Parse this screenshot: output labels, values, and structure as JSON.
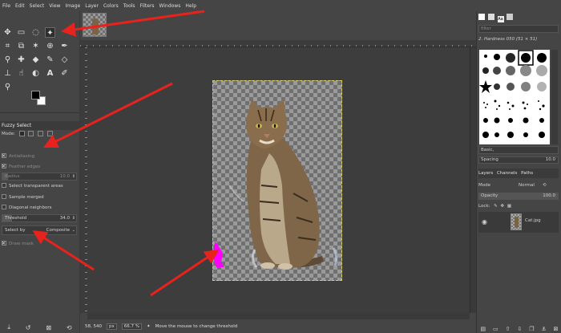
{
  "menu": [
    "File",
    "Edit",
    "Select",
    "View",
    "Image",
    "Layer",
    "Colors",
    "Tools",
    "Filters",
    "Windows",
    "Help"
  ],
  "tool_options": {
    "title": "Fuzzy Select",
    "mode_label": "Mode:",
    "antialiasing": {
      "label": "Antialiasing",
      "checked": true
    },
    "feather": {
      "label": "Feather edges",
      "checked": true
    },
    "radius": {
      "label": "Radius",
      "value": "10.0"
    },
    "select_transparent": {
      "label": "Select transparent areas",
      "checked": false
    },
    "sample_merged": {
      "label": "Sample merged",
      "checked": false
    },
    "diagonal": {
      "label": "Diagonal neighbors",
      "checked": false
    },
    "threshold": {
      "label": "Threshold",
      "value": "34.0"
    },
    "select_by": {
      "label": "Select by",
      "value": "Composite"
    },
    "draw_mask": {
      "label": "Draw mask",
      "checked": true
    }
  },
  "status": {
    "coords": "58, 540",
    "unit": "px",
    "zoom": "66.7 %",
    "message": "Move the mouse to change threshold"
  },
  "dock": {
    "filter_placeholder": "filter",
    "brush_name": "2. Hardness 050 (51 × 51)",
    "preset": "Basic,",
    "spacing_label": "Spacing",
    "spacing_value": "10.0",
    "tabs": [
      "Layers",
      "Channels",
      "Paths"
    ],
    "mode_label": "Mode",
    "mode_value": "Normal",
    "opacity_label": "Opacity",
    "opacity_value": "100.0",
    "lock_label": "Lock:",
    "layer_name": "Cat.jpg"
  },
  "colors": {
    "arrow": "#e8221c",
    "selection_border": "#d7d05a",
    "mask_magenta": "#ff00ff"
  }
}
